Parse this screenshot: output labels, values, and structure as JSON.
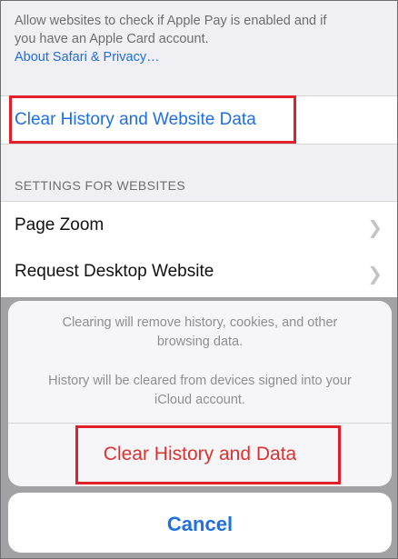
{
  "settings": {
    "apple_pay_note_line1": "Allow websites to check if Apple Pay is enabled and if",
    "apple_pay_note_line2": "you have an Apple Card account.",
    "privacy_link": "About Safari & Privacy…",
    "clear_history_label": "Clear History and Website Data",
    "section_header": "SETTINGS FOR WEBSITES",
    "items": [
      {
        "label": "Page Zoom",
        "icon": "chevron-right-icon"
      },
      {
        "label": "Request Desktop Website",
        "icon": "chevron-right-icon"
      }
    ]
  },
  "action_sheet": {
    "message_line1": "Clearing will remove history, cookies, and other",
    "message_line2": "browsing data.",
    "message_line3": "History will be cleared from devices signed into your",
    "message_line4": "iCloud account.",
    "confirm_label": "Clear History and Data",
    "cancel_label": "Cancel"
  },
  "colors": {
    "link": "#1f6fe0",
    "destructive": "#d9322f",
    "annotation": "#e0202a"
  }
}
